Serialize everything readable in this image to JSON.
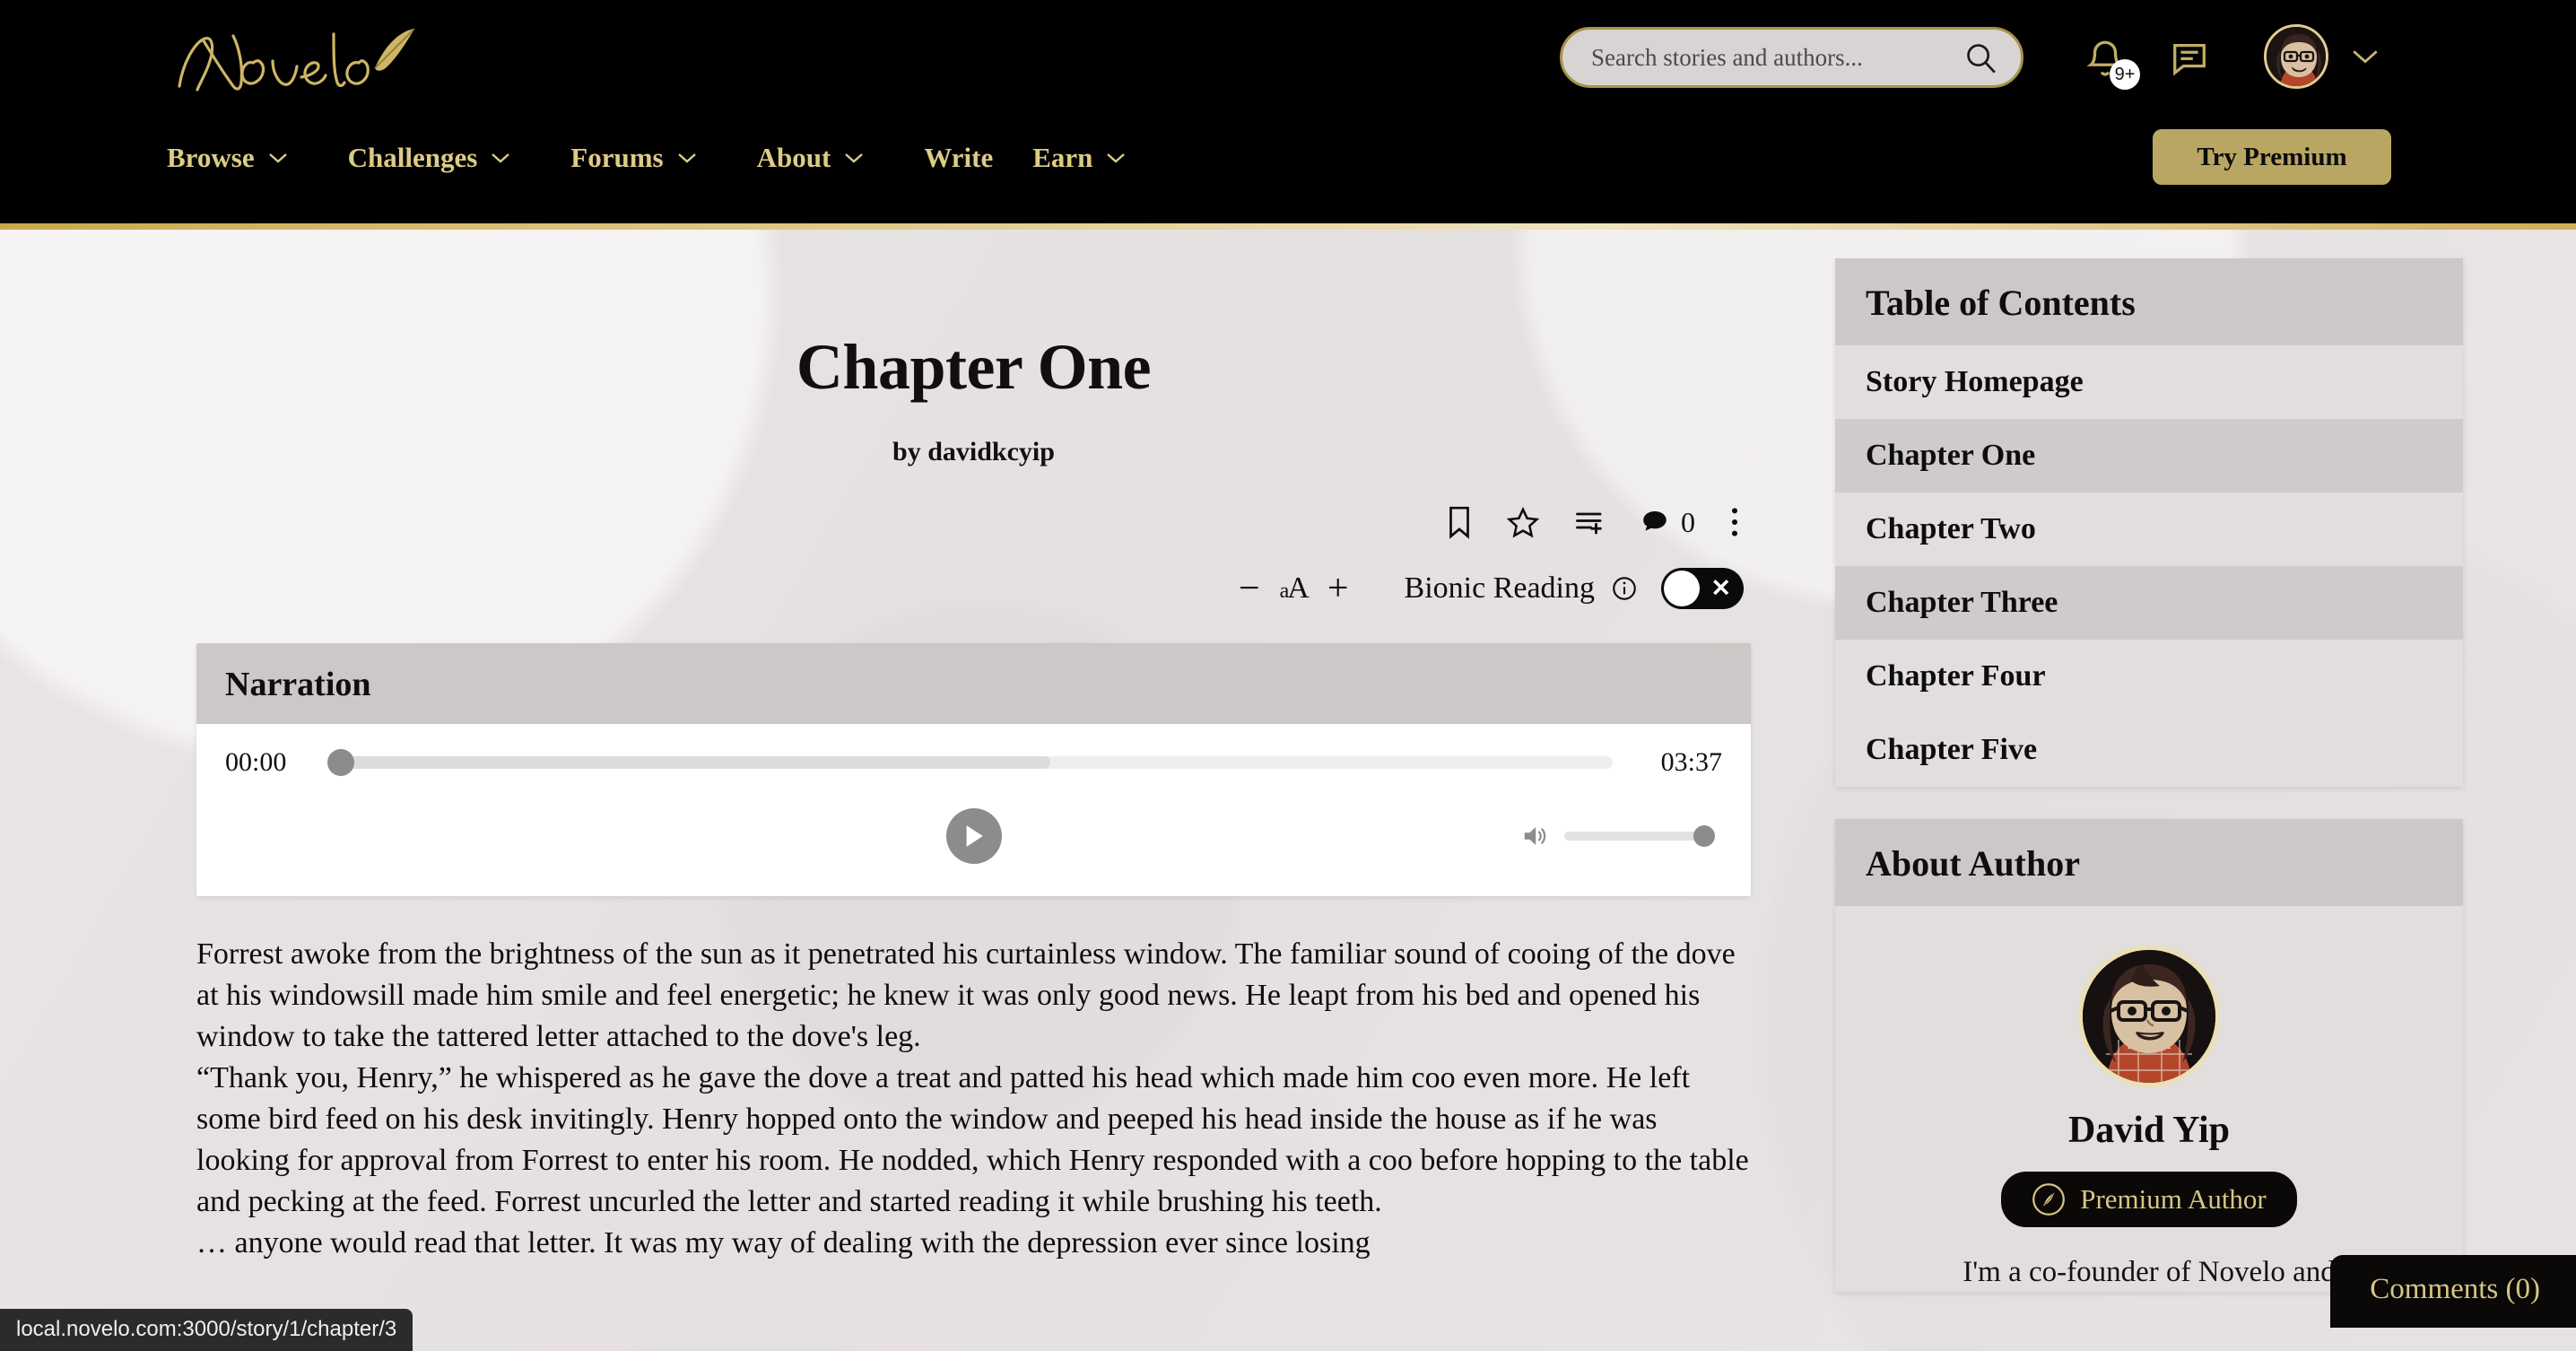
{
  "site": {
    "logo_text": "Novelo",
    "brand_gold": "#d8c584",
    "nav_gold": "#ddcb86",
    "premium_button_bg": "#b9a662"
  },
  "header": {
    "search": {
      "placeholder": "Search stories and authors...",
      "value": "",
      "icon": "search-icon"
    },
    "notifications": {
      "icon": "bell-icon",
      "badge": "9+"
    },
    "messages": {
      "icon": "chat-bubble-icon"
    },
    "account": {
      "icon": "avatar",
      "caret": "chevron-down-icon"
    },
    "try_premium_label": "Try Premium",
    "nav_items": [
      {
        "label": "Browse",
        "has_caret": true
      },
      {
        "label": "Challenges",
        "has_caret": true
      },
      {
        "label": "Forums",
        "has_caret": true
      },
      {
        "label": "About",
        "has_caret": true
      },
      {
        "label": "Write",
        "has_caret": false
      },
      {
        "label": "Earn",
        "has_caret": true
      }
    ]
  },
  "reader": {
    "chapter_title": "Chapter One",
    "byline": "by davidkcyip",
    "actions": {
      "bookmark": "bookmark-icon",
      "favorite": "star-icon",
      "add_to_list": "playlist-add-icon",
      "comments": "comment-icon",
      "comment_count": "0",
      "more": "more-vertical-icon"
    },
    "font_controls": {
      "decrease_label": "−",
      "size_label": "aA",
      "increase_label": "+",
      "bionic_label": "Bionic Reading",
      "info_icon": "info-icon",
      "toggle_state": "off",
      "toggle_glyph": "✕"
    },
    "narration": {
      "title": "Narration",
      "current_time": "00:00",
      "duration": "03:37",
      "progress_percent": 0,
      "buffered_percent": 56,
      "play_icon": "play-icon",
      "volume_icon": "volume-icon",
      "volume_percent": 100
    },
    "paragraphs": [
      "Forrest awoke from the brightness of the sun as it penetrated his curtainless window. The familiar sound of cooing of the dove at his windowsill made him smile and feel energetic; he knew it was only good news. He leapt from his bed and opened his window to take the tattered letter attached to the dove's leg.",
      "“Thank you, Henry,” he whispered as he gave the dove a treat and patted his head which made him coo even more. He left some bird feed on his desk invitingly. Henry hopped onto the window and peeped his head inside the house as if he was looking for approval from Forrest to enter his room. He nodded, which Henry responded with a coo before hopping to the table and pecking at the feed. Forrest uncurled the letter and started reading it while brushing his teeth.",
      "… anyone would read that letter. It was my way of dealing with the depression ever since losing"
    ]
  },
  "sidebar": {
    "toc": {
      "title": "Table of Contents",
      "items": [
        {
          "label": "Story Homepage",
          "active": false
        },
        {
          "label": "Chapter One",
          "active": true
        },
        {
          "label": "Chapter Two",
          "active": false
        },
        {
          "label": "Chapter Three",
          "active": true
        },
        {
          "label": "Chapter Four",
          "active": false
        },
        {
          "label": "Chapter Five",
          "active": false
        }
      ]
    },
    "author": {
      "title": "About Author",
      "name": "David Yip",
      "badge_label": "Premium Author",
      "badge_icon": "feather-icon",
      "bio": "I'm a co-founder of Novelo and"
    }
  },
  "floating": {
    "comments_label": "Comments (0)"
  },
  "status_bar": {
    "url": "local.novelo.com:3000/story/1/chapter/3"
  }
}
